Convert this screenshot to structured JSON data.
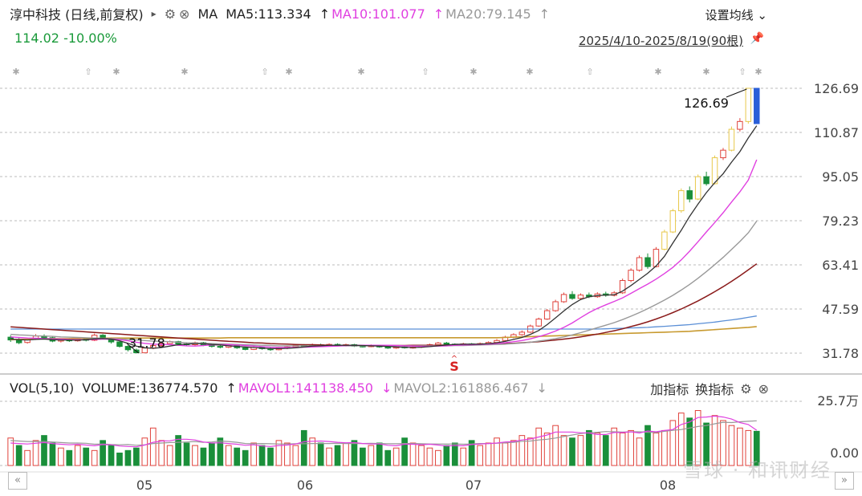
{
  "header": {
    "stock_title": "淳中科技 (日线,前复权)",
    "play_icon": "▸",
    "gear_icon": "⚙",
    "close_icon": "⊗",
    "ma_label": "MA",
    "ma5": "MA5:113.334",
    "ma10": "MA10:101.077",
    "ma20": "MA20:79.145",
    "settings_label": "设置均线",
    "price_change": "114.02 -10.00%",
    "date_range": "2025/4/10-2025/8/19(90根)"
  },
  "price_axis": {
    "ticks": [
      "126.69",
      "110.87",
      "95.05",
      "79.23",
      "63.41",
      "47.59",
      "31.78"
    ]
  },
  "annotations": {
    "high_label": "126.69",
    "low_label": "31.78",
    "signal_label": "S"
  },
  "volume_header": {
    "vol_label": "VOL(5,10)",
    "volume": "VOLUME:136774.570",
    "mavol1": "MAVOL1:141138.450",
    "mavol2": "MAVOL2:161886.467",
    "add_indicator": "加指标",
    "switch_indicator": "换指标"
  },
  "volume_axis": {
    "ticks": [
      "25.7万",
      "0.00"
    ]
  },
  "x_axis": {
    "ticks": [
      "05",
      "06",
      "07",
      "08"
    ]
  },
  "watermark": "雪球 · 和讯财经",
  "colors": {
    "up": "#e0433c",
    "down": "#1a8f3a",
    "ma5": "#333333",
    "ma10": "#e040e0",
    "ma20": "#999999",
    "highlight": "#e8c84a",
    "last": "#2a5fd8"
  },
  "chart_data": {
    "type": "candlestick",
    "ylim": [
      31.78,
      126.69
    ],
    "candles": [
      [
        37.5,
        36.5,
        38.2,
        35.8
      ],
      [
        36.6,
        35.5,
        37.2,
        35.0
      ],
      [
        35.6,
        36.8,
        37.3,
        35.2
      ],
      [
        36.8,
        37.9,
        38.6,
        36.5
      ],
      [
        37.9,
        37.2,
        38.5,
        36.8
      ],
      [
        37.3,
        36.1,
        37.8,
        35.7
      ],
      [
        36.1,
        36.6,
        37.0,
        35.6
      ],
      [
        36.6,
        36.2,
        37.2,
        35.8
      ],
      [
        36.2,
        36.9,
        37.5,
        35.9
      ],
      [
        36.9,
        36.4,
        37.3,
        36.0
      ],
      [
        36.4,
        38.2,
        38.8,
        36.1
      ],
      [
        38.2,
        37.1,
        38.6,
        36.7
      ],
      [
        37.1,
        35.8,
        37.4,
        35.2
      ],
      [
        35.8,
        34.2,
        36.0,
        33.8
      ],
      [
        34.2,
        33.0,
        34.6,
        32.4
      ],
      [
        32.9,
        31.9,
        33.4,
        31.78
      ],
      [
        31.9,
        33.6,
        34.0,
        31.8
      ],
      [
        33.6,
        34.5,
        35.0,
        33.2
      ],
      [
        34.5,
        35.2,
        35.6,
        34.1
      ],
      [
        35.2,
        35.9,
        36.3,
        34.8
      ],
      [
        35.9,
        35.1,
        36.2,
        34.7
      ],
      [
        35.1,
        34.8,
        35.6,
        34.3
      ],
      [
        34.8,
        35.5,
        35.9,
        34.5
      ],
      [
        35.5,
        34.7,
        35.8,
        34.3
      ],
      [
        34.7,
        34.2,
        35.0,
        33.8
      ],
      [
        34.2,
        33.9,
        34.6,
        33.5
      ],
      [
        33.9,
        34.6,
        35.0,
        33.6
      ],
      [
        34.6,
        33.7,
        34.9,
        33.3
      ],
      [
        33.7,
        33.1,
        34.0,
        32.8
      ],
      [
        33.1,
        33.8,
        34.2,
        32.9
      ],
      [
        33.8,
        33.4,
        34.2,
        33.0
      ],
      [
        33.4,
        33.0,
        33.8,
        32.6
      ],
      [
        33.0,
        33.6,
        34.0,
        32.8
      ],
      [
        33.6,
        34.0,
        34.4,
        33.2
      ],
      [
        34.0,
        34.6,
        35.0,
        33.7
      ],
      [
        34.6,
        34.2,
        35.0,
        33.9
      ],
      [
        34.2,
        34.8,
        35.2,
        33.9
      ],
      [
        34.8,
        34.4,
        35.2,
        34.0
      ],
      [
        34.4,
        34.9,
        35.3,
        34.1
      ],
      [
        34.9,
        34.5,
        35.3,
        34.2
      ],
      [
        34.5,
        34.8,
        35.2,
        34.2
      ],
      [
        34.8,
        34.3,
        35.1,
        34.0
      ],
      [
        34.3,
        34.1,
        34.7,
        33.8
      ],
      [
        34.1,
        34.5,
        34.9,
        33.9
      ],
      [
        34.5,
        34.0,
        34.8,
        33.7
      ],
      [
        34.0,
        33.6,
        34.3,
        33.3
      ],
      [
        33.6,
        34.0,
        34.3,
        33.3
      ],
      [
        34.0,
        33.7,
        34.3,
        33.4
      ],
      [
        33.7,
        33.9,
        34.2,
        33.4
      ],
      [
        33.9,
        34.3,
        34.6,
        33.6
      ],
      [
        34.3,
        34.8,
        35.2,
        34.0
      ],
      [
        34.8,
        35.4,
        35.8,
        34.6
      ],
      [
        35.4,
        35.0,
        35.8,
        34.7
      ],
      [
        35.0,
        34.7,
        35.3,
        34.4
      ],
      [
        34.7,
        35.1,
        35.5,
        34.4
      ],
      [
        35.1,
        34.8,
        35.4,
        34.5
      ],
      [
        34.8,
        35.2,
        35.6,
        34.5
      ],
      [
        35.2,
        35.6,
        36.0,
        34.9
      ],
      [
        35.6,
        36.3,
        36.8,
        35.3
      ],
      [
        36.3,
        37.5,
        38.0,
        36.0
      ],
      [
        37.5,
        38.4,
        38.9,
        37.1
      ],
      [
        38.4,
        39.3,
        39.9,
        38.0
      ],
      [
        39.3,
        41.5,
        42.0,
        39.0
      ],
      [
        41.5,
        44.0,
        44.5,
        41.2
      ],
      [
        44.0,
        47.0,
        47.6,
        43.7
      ],
      [
        47.0,
        50.2,
        50.9,
        46.6
      ],
      [
        50.2,
        52.8,
        53.5,
        49.8
      ],
      [
        52.8,
        51.4,
        54.0,
        50.9
      ],
      [
        51.4,
        52.6,
        53.2,
        50.8
      ],
      [
        52.6,
        52.0,
        53.5,
        51.5
      ],
      [
        52.0,
        53.0,
        53.6,
        51.6
      ],
      [
        53.0,
        52.5,
        53.8,
        52.0
      ],
      [
        52.5,
        53.4,
        54.0,
        52.1
      ],
      [
        53.4,
        57.8,
        58.5,
        53.0
      ],
      [
        57.8,
        61.5,
        62.2,
        57.2
      ],
      [
        61.5,
        66.0,
        66.8,
        61.0
      ],
      [
        66.0,
        62.8,
        67.5,
        62.0
      ],
      [
        62.8,
        69.0,
        69.8,
        62.5
      ],
      [
        69.0,
        75.2,
        76.0,
        68.6
      ],
      [
        75.2,
        82.8,
        83.5,
        74.8
      ],
      [
        82.8,
        90.0,
        90.8,
        82.1
      ],
      [
        90.0,
        87.0,
        91.5,
        85.8
      ],
      [
        87.0,
        95.0,
        95.8,
        86.6
      ],
      [
        95.0,
        92.5,
        96.8,
        91.8
      ],
      [
        92.5,
        101.8,
        102.6,
        92.2
      ],
      [
        101.8,
        104.5,
        105.3,
        101.0
      ],
      [
        104.5,
        112.0,
        113.0,
        104.1
      ],
      [
        112.0,
        114.8,
        116.0,
        111.2
      ],
      [
        114.8,
        126.69,
        126.69,
        114.0
      ],
      [
        126.69,
        114.02,
        126.69,
        114.0
      ]
    ],
    "ma5": [
      36.8,
      36.6,
      36.5,
      36.7,
      36.8,
      36.6,
      36.5,
      36.5,
      36.4,
      36.6,
      36.9,
      37.0,
      36.8,
      36.2,
      35.3,
      34.3,
      33.7,
      33.5,
      33.8,
      34.3,
      34.8,
      35.0,
      35.2,
      35.2,
      34.9,
      34.7,
      34.4,
      34.2,
      34.0,
      33.8,
      33.6,
      33.4,
      33.4,
      33.5,
      33.7,
      34.0,
      34.3,
      34.4,
      34.6,
      34.6,
      34.6,
      34.6,
      34.5,
      34.4,
      34.3,
      34.2,
      34.0,
      33.9,
      33.8,
      33.9,
      34.1,
      34.4,
      34.7,
      34.9,
      35.0,
      35.0,
      35.0,
      35.2,
      35.5,
      36.0,
      36.7,
      37.4,
      38.5,
      39.9,
      42.0,
      44.4,
      46.9,
      49.2,
      51.0,
      52.0,
      52.4,
      52.6,
      52.7,
      54.0,
      56.0,
      58.2,
      60.4,
      63.0,
      66.5,
      71.2,
      75.8,
      80.8,
      85.2,
      89.3,
      92.9,
      96.1,
      100.2,
      104.0,
      108.9,
      113.3
    ],
    "ma10": [
      37.6,
      37.4,
      37.2,
      37.1,
      37.0,
      36.9,
      36.8,
      36.7,
      36.6,
      36.6,
      36.7,
      36.8,
      36.8,
      36.6,
      36.2,
      35.7,
      35.3,
      35.0,
      34.9,
      34.9,
      34.6,
      34.4,
      34.3,
      34.5,
      34.7,
      34.8,
      34.8,
      34.7,
      34.5,
      34.3,
      34.1,
      33.9,
      33.8,
      33.8,
      33.8,
      33.9,
      34.0,
      34.1,
      34.2,
      34.3,
      34.5,
      34.6,
      34.6,
      34.6,
      34.6,
      34.6,
      34.5,
      34.4,
      34.3,
      34.2,
      34.2,
      34.3,
      34.4,
      34.6,
      34.7,
      34.8,
      34.9,
      35.0,
      35.2,
      35.5,
      35.9,
      36.3,
      36.9,
      37.7,
      38.6,
      39.7,
      41.0,
      42.6,
      44.5,
      46.3,
      47.8,
      49.1,
      50.3,
      51.6,
      53.2,
      54.9,
      56.5,
      58.3,
      60.3,
      62.5,
      65.2,
      68.3,
      71.7,
      75.2,
      78.6,
      82.1,
      85.9,
      89.6,
      93.8,
      101.1
    ],
    "ma20": [
      38.5,
      38.3,
      38.2,
      38.0,
      37.9,
      37.8,
      37.6,
      37.5,
      37.4,
      37.3,
      37.2,
      37.1,
      37.0,
      36.9,
      36.7,
      36.5,
      36.3,
      36.1,
      36.0,
      35.9,
      35.7,
      35.5,
      35.4,
      35.3,
      35.2,
      35.1,
      35.0,
      34.9,
      34.8,
      34.7,
      34.6,
      34.5,
      34.4,
      34.4,
      34.4,
      34.4,
      34.4,
      34.4,
      34.4,
      34.4,
      34.4,
      34.4,
      34.4,
      34.4,
      34.4,
      34.4,
      34.4,
      34.4,
      34.4,
      34.4,
      34.4,
      34.4,
      34.4,
      34.5,
      34.5,
      34.6,
      34.7,
      34.8,
      34.9,
      35.0,
      35.2,
      35.4,
      35.7,
      36.1,
      36.5,
      37.0,
      37.6,
      38.3,
      39.1,
      40.0,
      40.9,
      41.8,
      42.7,
      43.8,
      45.0,
      46.3,
      47.7,
      49.2,
      50.8,
      52.5,
      54.4,
      56.4,
      58.6,
      61.0,
      63.5,
      66.1,
      68.9,
      71.8,
      74.9,
      79.1
    ],
    "ma_long1": [
      41.2,
      41.0,
      40.8,
      40.6,
      40.4,
      40.2,
      40.0,
      39.8,
      39.6,
      39.4,
      39.2,
      39.0,
      38.8,
      38.6,
      38.4,
      38.2,
      38.0,
      37.8,
      37.6,
      37.4,
      37.2,
      37.0,
      36.8,
      36.6,
      36.4,
      36.2,
      36.0,
      35.9,
      35.7,
      35.5,
      35.4,
      35.2,
      35.1,
      35.0,
      34.9,
      34.8,
      34.8,
      34.7,
      34.6,
      34.6,
      34.5,
      34.5,
      34.5,
      34.5,
      34.5,
      34.5,
      34.5,
      34.5,
      34.6,
      34.6,
      34.6,
      34.6,
      34.7,
      34.7,
      34.8,
      34.8,
      34.9,
      35.0,
      35.1,
      35.2,
      35.3,
      35.5,
      35.7,
      35.9,
      36.2,
      36.5,
      36.8,
      37.2,
      37.6,
      38.1,
      38.6,
      39.2,
      39.8,
      40.5,
      41.3,
      42.1,
      43.0,
      44.0,
      45.1,
      46.3,
      47.6,
      49.0,
      50.5,
      52.1,
      53.8,
      55.6,
      57.5,
      59.5,
      61.6,
      63.8
    ],
    "ma_long2": [
      40.4,
      40.4,
      40.4,
      40.4,
      40.4,
      40.4,
      40.4,
      40.4,
      40.4,
      40.4,
      40.4,
      40.4,
      40.4,
      40.4,
      40.4,
      40.4,
      40.4,
      40.4,
      40.4,
      40.4,
      40.4,
      40.4,
      40.4,
      40.4,
      40.4,
      40.4,
      40.4,
      40.4,
      40.4,
      40.4,
      40.4,
      40.4,
      40.4,
      40.4,
      40.4,
      40.4,
      40.4,
      40.4,
      40.4,
      40.4,
      40.4,
      40.4,
      40.4,
      40.4,
      40.4,
      40.4,
      40.4,
      40.4,
      40.4,
      40.4,
      40.4,
      40.4,
      40.4,
      40.4,
      40.4,
      40.4,
      40.4,
      40.4,
      40.4,
      40.4,
      40.4,
      40.4,
      40.4,
      40.4,
      40.4,
      40.4,
      40.4,
      40.4,
      40.4,
      40.4,
      40.4,
      40.5,
      40.6,
      40.7,
      40.8,
      40.9,
      41.0,
      41.2,
      41.4,
      41.6,
      41.8,
      42.0,
      42.3,
      42.6,
      42.9,
      43.3,
      43.7,
      44.1,
      44.6,
      45.1
    ],
    "ma_long3": [
      36.6,
      36.7,
      36.8,
      36.9,
      36.9,
      37.0,
      37.0,
      37.0,
      37.1,
      37.1,
      37.1,
      37.1,
      37.2,
      37.2,
      37.2,
      37.2,
      37.2,
      37.2,
      37.2,
      37.2,
      37.2,
      37.2,
      37.2,
      37.2,
      37.2,
      37.2,
      37.3,
      37.3,
      37.3,
      37.3,
      37.3,
      37.3,
      37.3,
      37.3,
      37.3,
      37.3,
      37.3,
      37.3,
      37.3,
      37.3,
      37.3,
      37.3,
      37.3,
      37.3,
      37.3,
      37.3,
      37.3,
      37.3,
      37.3,
      37.3,
      37.3,
      37.3,
      37.3,
      37.3,
      37.3,
      37.3,
      37.3,
      37.3,
      37.3,
      37.4,
      37.5,
      37.6,
      37.7,
      37.8,
      37.9,
      38.0,
      38.1,
      38.2,
      38.3,
      38.4,
      38.5,
      38.6,
      38.7,
      38.8,
      38.9,
      39.0,
      39.1,
      39.2,
      39.3,
      39.4,
      39.5,
      39.6,
      39.8,
      40.0,
      40.2,
      40.4,
      40.6,
      40.8,
      41.0,
      41.3
    ],
    "volume": [
      11,
      8,
      6,
      10,
      12,
      9,
      7,
      6,
      8,
      7,
      6,
      10,
      8,
      5,
      6,
      7,
      11,
      15,
      10,
      8,
      12,
      9,
      8,
      7,
      9,
      11,
      8,
      7,
      6,
      9,
      8,
      7,
      10,
      9,
      8,
      14,
      11,
      9,
      7,
      8,
      9,
      10,
      7,
      8,
      9,
      6,
      7,
      11,
      9,
      8,
      7,
      6,
      8,
      9,
      7,
      10,
      8,
      9,
      11,
      9,
      10,
      12,
      11,
      15,
      13,
      16,
      12,
      11,
      12,
      14,
      13,
      12,
      15,
      13,
      14,
      11,
      16,
      13,
      14,
      18,
      21,
      19,
      22,
      17,
      20,
      18,
      16,
      15,
      14,
      13.7
    ],
    "volume_up": [
      true,
      false,
      true,
      true,
      false,
      false,
      true,
      false,
      true,
      false,
      true,
      false,
      false,
      false,
      false,
      false,
      true,
      true,
      true,
      true,
      false,
      false,
      true,
      false,
      false,
      false,
      true,
      false,
      false,
      true,
      false,
      false,
      true,
      true,
      true,
      false,
      true,
      false,
      true,
      false,
      true,
      false,
      false,
      true,
      false,
      false,
      true,
      false,
      true,
      true,
      true,
      true,
      false,
      false,
      true,
      false,
      true,
      true,
      true,
      true,
      true,
      true,
      true,
      true,
      true,
      true,
      true,
      false,
      true,
      false,
      true,
      false,
      true,
      true,
      true,
      true,
      false,
      true,
      true,
      true,
      true,
      false,
      true,
      false,
      true,
      true,
      true,
      true,
      true,
      false
    ],
    "mavol1": [
      9,
      8.8,
      8.6,
      8.9,
      9.2,
      8.8,
      8.5,
      8.3,
      8.5,
      8.2,
      7.9,
      8.4,
      8.3,
      7.8,
      7.6,
      7.5,
      8.2,
      9.3,
      9.8,
      9.9,
      10.5,
      10.5,
      10.2,
      9.4,
      9.0,
      9.1,
      8.8,
      8.5,
      8.1,
      8.3,
      7.8,
      7.6,
      8.0,
      8.2,
      8.6,
      9.5,
      9.7,
      9.8,
      9.6,
      9.3,
      9.1,
      9.2,
      8.8,
      8.6,
      8.6,
      8.1,
      7.9,
      8.5,
      8.5,
      8.3,
      8.5,
      8.2,
      7.8,
      8.0,
      7.9,
      8.4,
      8.6,
      8.8,
      9.0,
      9.4,
      9.6,
      10.2,
      10.6,
      11.4,
      12.2,
      13.4,
      13.4,
      13.4,
      13.1,
      13.0,
      12.4,
      12.4,
      13.2,
      13.2,
      13.5,
      13.0,
      13.8,
      13.5,
      14.0,
      14.4,
      16.4,
      17.4,
      19.2,
      19.4,
      19.8,
      19.4,
      18.6,
      17.2,
      16.4,
      14.1
    ],
    "mavol2": [
      10,
      9.8,
      9.6,
      9.6,
      9.6,
      9.4,
      9.2,
      9.0,
      9.0,
      8.9,
      8.5,
      8.6,
      8.4,
      8.3,
      8.4,
      8.1,
      8.3,
      8.8,
      9.0,
      9.2,
      9.3,
      9.4,
      9.6,
      9.3,
      9.4,
      9.8,
      9.6,
      9.3,
      8.8,
      8.7,
      8.8,
      8.7,
      8.6,
      8.6,
      8.7,
      8.7,
      8.8,
      8.8,
      8.8,
      8.9,
      8.8,
      8.8,
      8.8,
      8.9,
      8.8,
      8.7,
      8.7,
      8.8,
      8.8,
      8.7,
      8.6,
      8.6,
      8.6,
      8.6,
      8.5,
      8.6,
      8.8,
      8.8,
      8.9,
      9.1,
      9.3,
      9.7,
      9.8,
      10.2,
      10.5,
      11.0,
      11.6,
      12.2,
      12.8,
      13.1,
      13.3,
      13.6,
      13.5,
      13.4,
      13.5,
      13.5,
      13.3,
      13.2,
      13.7,
      14.1,
      14.4,
      15.0,
      15.6,
      16.0,
      16.7,
      17.3,
      17.2,
      17.5,
      17.7,
      17.9
    ],
    "volume_ylim": [
      0,
      25.7
    ]
  }
}
